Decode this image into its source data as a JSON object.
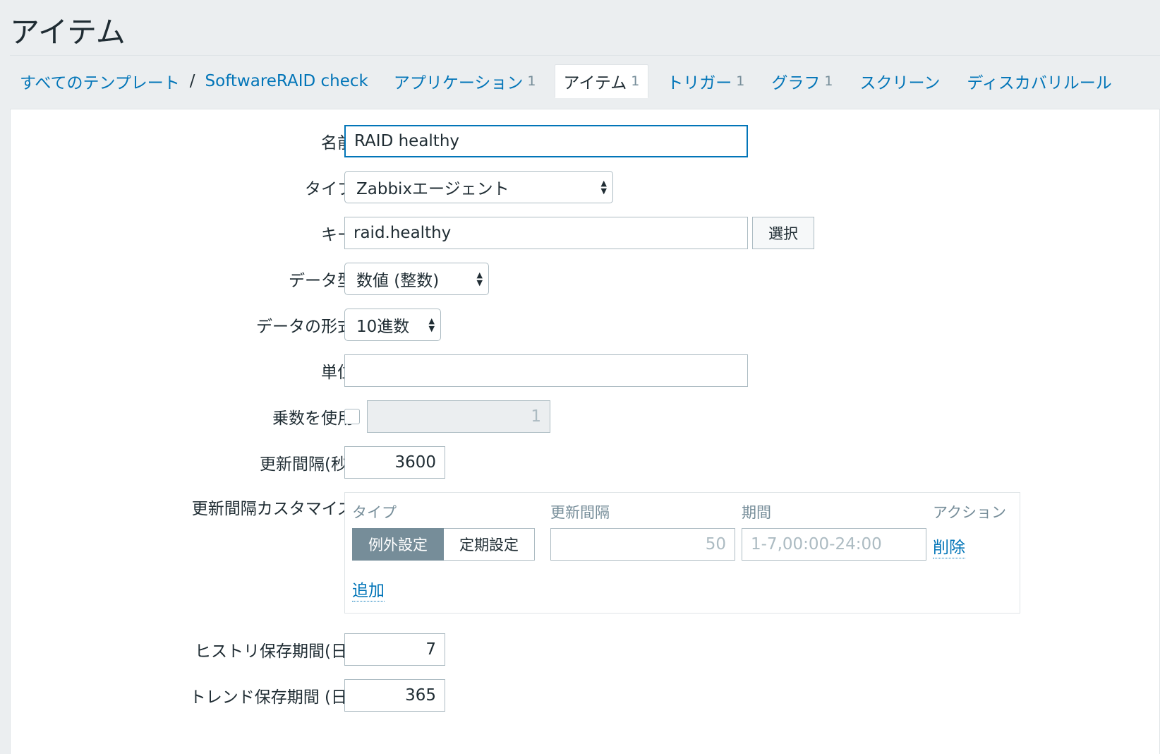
{
  "page": {
    "title": "アイテム"
  },
  "breadcrumb": {
    "all_templates": "すべてのテンプレート",
    "separator": "/",
    "template": "SoftwareRAID check"
  },
  "tabs": [
    {
      "label": "アプリケーション",
      "count": "1",
      "active": false
    },
    {
      "label": "アイテム",
      "count": "1",
      "active": true
    },
    {
      "label": "トリガー",
      "count": "1",
      "active": false
    },
    {
      "label": "グラフ",
      "count": "1",
      "active": false
    },
    {
      "label": "スクリーン",
      "count": "",
      "active": false
    },
    {
      "label": "ディスカバリルール",
      "count": "",
      "active": false
    }
  ],
  "form": {
    "name": {
      "label": "名前",
      "value": "RAID healthy"
    },
    "type": {
      "label": "タイプ",
      "value": "Zabbixエージェント"
    },
    "key": {
      "label": "キー",
      "value": "raid.healthy",
      "select_button": "選択"
    },
    "data_type": {
      "label": "データ型",
      "value": "数値 (整数)"
    },
    "data_format": {
      "label": "データの形式",
      "value": "10進数"
    },
    "units": {
      "label": "単位",
      "value": ""
    },
    "multiplier": {
      "label": "乗数を使用",
      "checked": false,
      "value": "1"
    },
    "interval": {
      "label": "更新間隔(秒)",
      "value": "3600"
    },
    "custom_intervals": {
      "label": "更新間隔カスタマイズ",
      "headers": {
        "type": "タイプ",
        "interval": "更新間隔",
        "period": "期間",
        "action": "アクション"
      },
      "row": {
        "flexible": "例外設定",
        "scheduling": "定期設定",
        "interval_placeholder": "50",
        "period_placeholder": "1-7,00:00-24:00",
        "remove": "削除"
      },
      "add": "追加"
    },
    "history": {
      "label": "ヒストリ保存期間(日)",
      "value": "7"
    },
    "trends": {
      "label": "トレンド保存期間 (日)",
      "value": "365"
    }
  },
  "colors": {
    "link": "#0275b8",
    "text": "#1f2c33",
    "muted": "#768d99",
    "background": "#ebeef0"
  }
}
